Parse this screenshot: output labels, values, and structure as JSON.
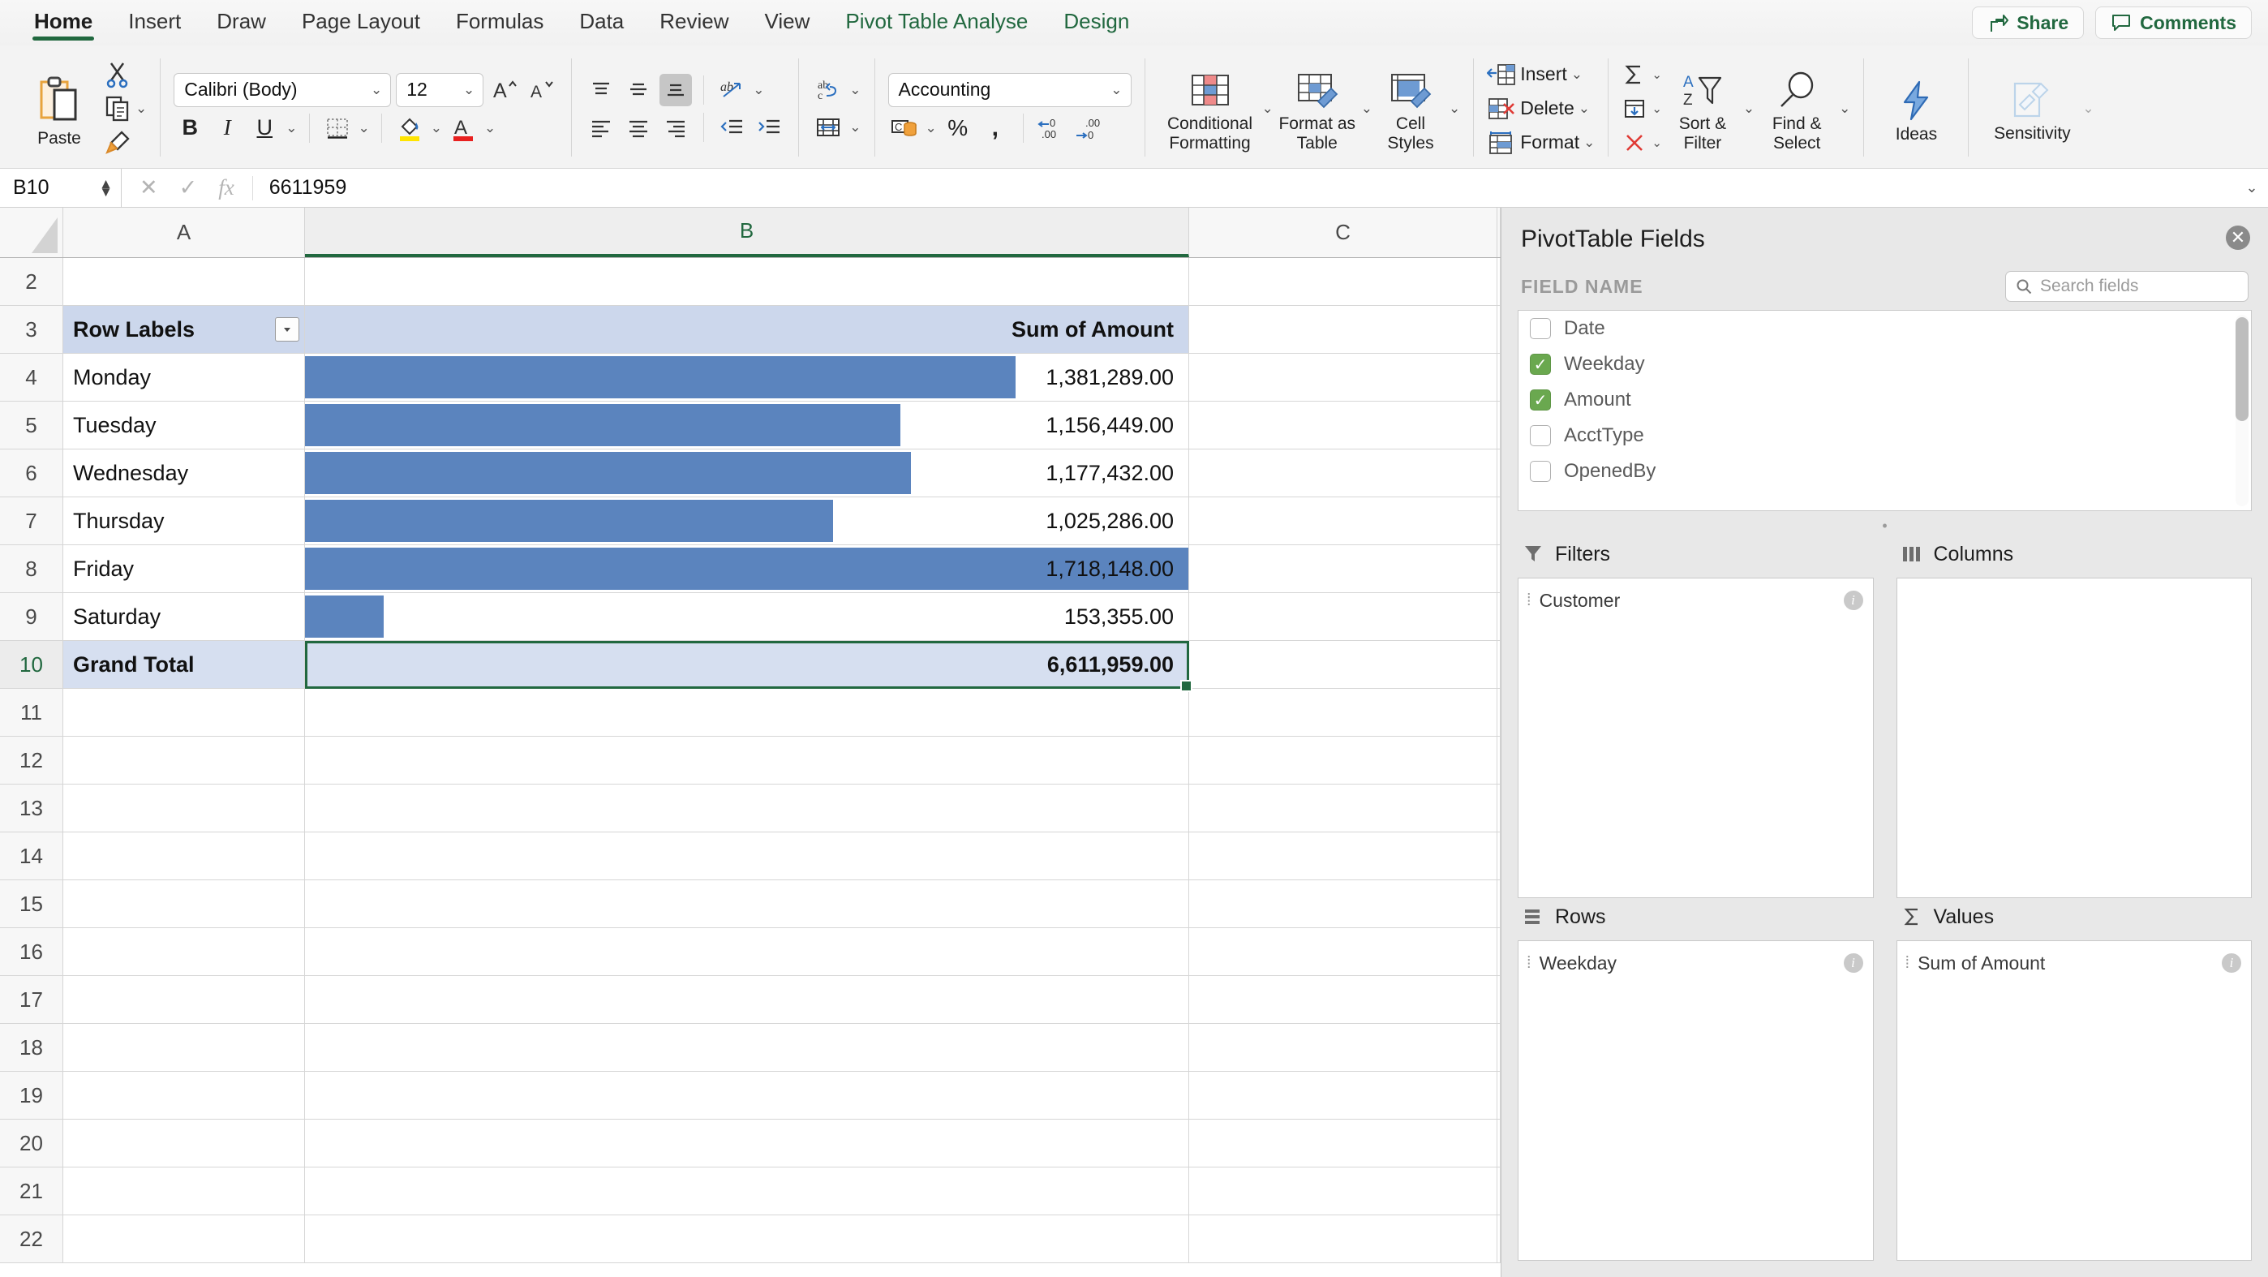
{
  "ribbon": {
    "tabs": [
      {
        "label": "Home",
        "state": "active"
      },
      {
        "label": "Insert",
        "state": "normal"
      },
      {
        "label": "Draw",
        "state": "normal"
      },
      {
        "label": "Page Layout",
        "state": "normal"
      },
      {
        "label": "Formulas",
        "state": "normal"
      },
      {
        "label": "Data",
        "state": "normal"
      },
      {
        "label": "Review",
        "state": "normal"
      },
      {
        "label": "View",
        "state": "normal"
      },
      {
        "label": "Pivot Table Analyse",
        "state": "contextual"
      },
      {
        "label": "Design",
        "state": "contextual"
      }
    ],
    "share_label": "Share",
    "comments_label": "Comments",
    "paste_label": "Paste",
    "font_name": "Calibri (Body)",
    "font_size": "12",
    "number_format": "Accounting",
    "conditional_formatting_label": "Conditional Formatting",
    "format_as_table_label": "Format as Table",
    "cell_styles_label": "Cell Styles",
    "insert_label": "Insert",
    "delete_label": "Delete",
    "format_label": "Format",
    "sort_filter_label": "Sort & Filter",
    "find_select_label": "Find & Select",
    "ideas_label": "Ideas",
    "sensitivity_label": "Sensitivity",
    "accent_green": "#21683f"
  },
  "formula_bar": {
    "name_box": "B10",
    "value": "6611959"
  },
  "grid": {
    "columns": [
      {
        "label": "A",
        "selected": false
      },
      {
        "label": "B",
        "selected": true
      },
      {
        "label": "C",
        "selected": false
      }
    ],
    "rows": [
      {
        "num": "2",
        "a": "",
        "b": "",
        "selected": false,
        "style": "plain",
        "bar_pct": 0
      },
      {
        "num": "3",
        "a": "Row Labels",
        "b": "Sum of Amount",
        "selected": false,
        "style": "header",
        "bar_pct": 0
      },
      {
        "num": "4",
        "a": "Monday",
        "b": "1,381,289.00",
        "selected": false,
        "style": "data",
        "bar_pct": 80.4
      },
      {
        "num": "5",
        "a": "Tuesday",
        "b": "1,156,449.00",
        "selected": false,
        "style": "data",
        "bar_pct": 67.3
      },
      {
        "num": "6",
        "a": "Wednesday",
        "b": "1,177,432.00",
        "selected": false,
        "style": "data",
        "bar_pct": 68.5
      },
      {
        "num": "7",
        "a": "Thursday",
        "b": "1,025,286.00",
        "selected": false,
        "style": "data",
        "bar_pct": 59.7
      },
      {
        "num": "8",
        "a": "Friday",
        "b": "1,718,148.00",
        "selected": false,
        "style": "data",
        "bar_pct": 100
      },
      {
        "num": "9",
        "a": "Saturday",
        "b": "153,355.00",
        "selected": false,
        "style": "data",
        "bar_pct": 8.9
      },
      {
        "num": "10",
        "a": "Grand Total",
        "b": "6,611,959.00",
        "selected": true,
        "style": "total",
        "bar_pct": 0
      },
      {
        "num": "11",
        "a": "",
        "b": "",
        "selected": false,
        "style": "plain",
        "bar_pct": 0
      },
      {
        "num": "12",
        "a": "",
        "b": "",
        "selected": false,
        "style": "plain",
        "bar_pct": 0
      },
      {
        "num": "13",
        "a": "",
        "b": "",
        "selected": false,
        "style": "plain",
        "bar_pct": 0
      },
      {
        "num": "14",
        "a": "",
        "b": "",
        "selected": false,
        "style": "plain",
        "bar_pct": 0
      },
      {
        "num": "15",
        "a": "",
        "b": "",
        "selected": false,
        "style": "plain",
        "bar_pct": 0
      },
      {
        "num": "16",
        "a": "",
        "b": "",
        "selected": false,
        "style": "plain",
        "bar_pct": 0
      },
      {
        "num": "17",
        "a": "",
        "b": "",
        "selected": false,
        "style": "plain",
        "bar_pct": 0
      },
      {
        "num": "18",
        "a": "",
        "b": "",
        "selected": false,
        "style": "plain",
        "bar_pct": 0
      },
      {
        "num": "19",
        "a": "",
        "b": "",
        "selected": false,
        "style": "plain",
        "bar_pct": 0
      },
      {
        "num": "20",
        "a": "",
        "b": "",
        "selected": false,
        "style": "plain",
        "bar_pct": 0
      },
      {
        "num": "21",
        "a": "",
        "b": "",
        "selected": false,
        "style": "plain",
        "bar_pct": 0
      },
      {
        "num": "22",
        "a": "",
        "b": "",
        "selected": false,
        "style": "plain",
        "bar_pct": 0
      }
    ],
    "databar_color": "#5b84be",
    "header_fill": "#ccd7ec",
    "total_fill": "#d6dff0"
  },
  "chart_data": {
    "type": "bar",
    "title": "Sum of Amount",
    "categories": [
      "Monday",
      "Tuesday",
      "Wednesday",
      "Thursday",
      "Friday",
      "Saturday"
    ],
    "values": [
      1381289,
      1156449,
      1177432,
      1025286,
      1718148,
      153355
    ],
    "grand_total": 6611959,
    "xlabel": "Weekday",
    "ylabel": "Sum of Amount",
    "ylim": [
      0,
      1718148
    ],
    "legend": "none",
    "grid": false,
    "note": "In-cell Excel data bars, conditional formatting; bar length proportional to value with max = Friday"
  },
  "pivot": {
    "title": "PivotTable Fields",
    "field_name_header": "FIELD NAME",
    "search_placeholder": "Search fields",
    "fields": [
      {
        "label": "Date",
        "checked": false
      },
      {
        "label": "Weekday",
        "checked": true
      },
      {
        "label": "Amount",
        "checked": true
      },
      {
        "label": "AcctType",
        "checked": false
      },
      {
        "label": "OpenedBy",
        "checked": false
      }
    ],
    "zones": [
      {
        "key": "filters",
        "label": "Filters",
        "items": [
          "Customer"
        ]
      },
      {
        "key": "columns",
        "label": "Columns",
        "items": []
      },
      {
        "key": "rows",
        "label": "Rows",
        "items": [
          "Weekday"
        ]
      },
      {
        "key": "values",
        "label": "Values",
        "items": [
          "Sum of Amount"
        ]
      }
    ]
  }
}
